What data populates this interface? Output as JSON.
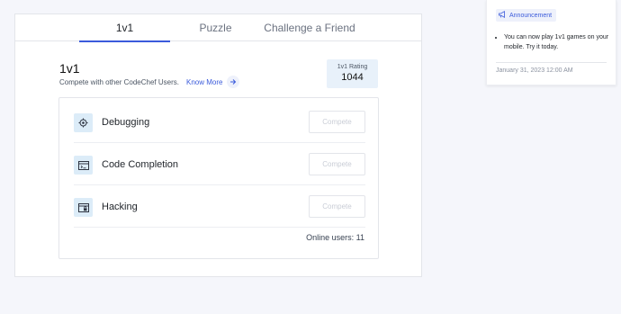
{
  "tabs": [
    {
      "label": "1v1",
      "active": true
    },
    {
      "label": "Puzzle",
      "active": false
    },
    {
      "label": "Challenge a Friend",
      "active": false
    }
  ],
  "mode": {
    "title": "1v1",
    "subtitle": "Compete with other CodeChef Users.",
    "know_more": "Know More",
    "rating_label": "1v1 Rating",
    "rating_value": "1044"
  },
  "modes": [
    {
      "name": "Debugging",
      "icon": "target-icon",
      "button": "Compete"
    },
    {
      "name": "Code Completion",
      "icon": "code-window-icon",
      "button": "Compete"
    },
    {
      "name": "Hacking",
      "icon": "browser-lock-icon",
      "button": "Compete"
    }
  ],
  "online_users": "Online users: 11",
  "announcement": {
    "tag": "Announcement",
    "text": "You can now play 1v1 games on your mobile. Try it today.",
    "date": "January 31, 2023 12:00 AM"
  },
  "colors": {
    "accent": "#3b5bdb",
    "icon_bg": "#dcecf8",
    "page_bg": "#f5f6fb"
  }
}
